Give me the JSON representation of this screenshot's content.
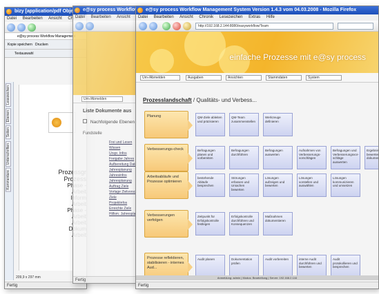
{
  "win1": {
    "title": "bizy [application/pdf Objekt]",
    "menu": [
      "Datei",
      "Bearbeiten",
      "Ansicht",
      "Chronik",
      "Lesezeichen"
    ],
    "toolbar_items": [
      "Kopie speichern",
      "Drucken"
    ],
    "tab_label": "e@sy process Workflow Management",
    "page_size": "209,9 x 297 mm",
    "sidebar_tabs": [
      "Lesezeichen",
      "Ebenen",
      "Seiten",
      "Unterschriften",
      "Kommentare"
    ],
    "page_lines": [
      "Prozessgr",
      "Prozess",
      "Phase -",
      "Arbeit",
      "Inform",
      "Arbeit",
      "Phase -",
      "Arbeit",
      "Arbeit",
      "Dokum",
      "Arbeit"
    ],
    "status": "Fertig",
    "tool_label": "Textauswahl"
  },
  "win2": {
    "title": "e@sy process Workflow",
    "menu": [
      "Datei",
      "Bearbeiten",
      "Ansicht"
    ],
    "nav_label": "Um-/Abmelden",
    "list_title": "Liste Dokumente aus",
    "checkbox_label": "Nachfolgende Ebenen",
    "fundstelle": "Fundstelle",
    "items": [
      "Frei und Lesen",
      "Wissen",
      "Urspr. Infos",
      "Freigabe Jahres",
      "Aufbereitung Daten",
      "Jahresplanung",
      "Jahresinfos",
      "Jahresplanung",
      "Auftrag Ziele",
      "Vorlage Zielvorschlag",
      "Ziele",
      "Projektinfos",
      "Erreichte Ziele",
      "Hilfsm. Jahresplanung"
    ],
    "status": "Fertig"
  },
  "win3": {
    "title": "e@sy process Workflow Management System Version 1.4.3 vom 04.03.2008 - Mozilla Firefox",
    "menu": [
      "Datei",
      "Bearbeiten",
      "Ansicht",
      "Chronik",
      "Lesezeichen",
      "Extras",
      "Hilfe"
    ],
    "url": "http://192.168.2.144:8080/easyworkflow/Team",
    "banner_text": "einfache Prozesse mit e@sy process",
    "nav": [
      "Um-/Abmelden",
      "Ausgaben",
      "Ansichten",
      "Stammdaten",
      "System"
    ],
    "breadcrumb_bold": "Prozesslandschaft",
    "breadcrumb_rest": " / Qualitäts- und Verbess...",
    "rows": [
      {
        "phase": "Planung",
        "steps": [
          "QM-Ziele ableiten und präzisieren",
          "QM-Team zusammenstellen",
          "Werkzeuge definieren"
        ]
      },
      {
        "phase": "Verbesserungs-check",
        "steps": [
          "Befragungen planen und vorbereiten",
          "Befragungen durchführen",
          "Befragungen auswerten",
          "Aufnahmen von Verbesserungs-vorschlägen",
          "Befragungen und Verbesserungsvor-schläge auswerten",
          "Ergebnisse bewerten und dokumentieren"
        ]
      },
      {
        "phase": "Arbeitsabläufe und Prozesse optimieren",
        "steps": [
          "bestehende Abläufe besprechen",
          "Störungen erfassen und Ursachen bewerten",
          "Lösungen aufzeigen und bewerten",
          "Lösungen vorstellen und auswählen",
          "Lösungen kommunizieren und umsetzen"
        ]
      },
      {
        "phase": "Verbesserungen verfolgen",
        "steps": [
          "Zeitpunkt für Erfolgskontrolle festlegen",
          "Erfolgskontrolle durchführen und Konsequenzen",
          "Maßnahmen dokumentieren"
        ]
      },
      {
        "phase": "Prozesse reflektieren, stabilisieren - internes Aud...",
        "steps": [
          "Audit planen",
          "Dokumentation prüfen",
          "Audit vorbereiten",
          "interne Audit durchführen und bewerten",
          "Audit protokollieren und besprechen"
        ]
      }
    ],
    "footer": "Anmeldung: admin | Modus: Bearbeitung | Server: 192.168.2.144",
    "status": "Fertig"
  }
}
